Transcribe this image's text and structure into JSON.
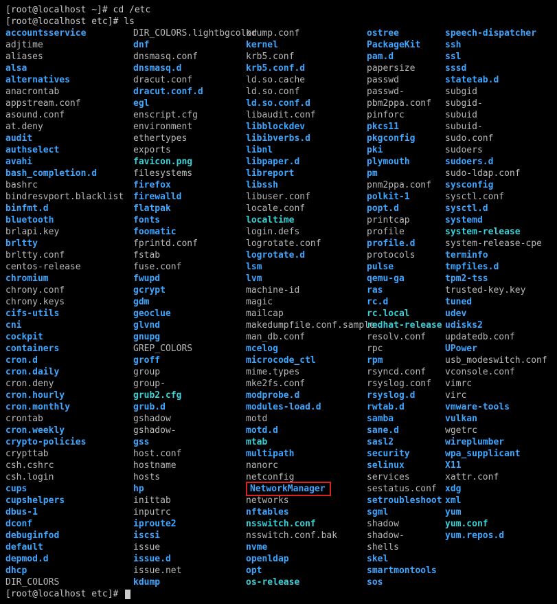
{
  "prompts": {
    "p1_prefix": "[root@localhost ~]# ",
    "p1_cmd": "cd /etc",
    "p2_prefix": "[root@localhost etc]# ",
    "p2_cmd": "ls",
    "p3_prefix": "[root@localhost etc]# "
  },
  "highlight_name": "NetworkManager",
  "columns": [
    [
      {
        "name": "accountsservice",
        "cls": "dir"
      },
      {
        "name": "adjtime",
        "cls": "file"
      },
      {
        "name": "aliases",
        "cls": "file"
      },
      {
        "name": "alsa",
        "cls": "dir"
      },
      {
        "name": "alternatives",
        "cls": "dir"
      },
      {
        "name": "anacrontab",
        "cls": "file"
      },
      {
        "name": "appstream.conf",
        "cls": "file"
      },
      {
        "name": "asound.conf",
        "cls": "file"
      },
      {
        "name": "at.deny",
        "cls": "file"
      },
      {
        "name": "audit",
        "cls": "dir"
      },
      {
        "name": "authselect",
        "cls": "dir"
      },
      {
        "name": "avahi",
        "cls": "dir"
      },
      {
        "name": "bash_completion.d",
        "cls": "dir"
      },
      {
        "name": "bashrc",
        "cls": "file"
      },
      {
        "name": "bindresvport.blacklist",
        "cls": "file"
      },
      {
        "name": "binfmt.d",
        "cls": "dir"
      },
      {
        "name": "bluetooth",
        "cls": "dir"
      },
      {
        "name": "brlapi.key",
        "cls": "file"
      },
      {
        "name": "brltty",
        "cls": "dir"
      },
      {
        "name": "brltty.conf",
        "cls": "file"
      },
      {
        "name": "centos-release",
        "cls": "file"
      },
      {
        "name": "chromium",
        "cls": "dir"
      },
      {
        "name": "chrony.conf",
        "cls": "file"
      },
      {
        "name": "chrony.keys",
        "cls": "file"
      },
      {
        "name": "cifs-utils",
        "cls": "dir"
      },
      {
        "name": "cni",
        "cls": "dir"
      },
      {
        "name": "cockpit",
        "cls": "dir"
      },
      {
        "name": "containers",
        "cls": "dir"
      },
      {
        "name": "cron.d",
        "cls": "dir"
      },
      {
        "name": "cron.daily",
        "cls": "dir"
      },
      {
        "name": "cron.deny",
        "cls": "file"
      },
      {
        "name": "cron.hourly",
        "cls": "dir"
      },
      {
        "name": "cron.monthly",
        "cls": "dir"
      },
      {
        "name": "crontab",
        "cls": "file"
      },
      {
        "name": "cron.weekly",
        "cls": "dir"
      },
      {
        "name": "crypto-policies",
        "cls": "dir"
      },
      {
        "name": "crypttab",
        "cls": "file"
      },
      {
        "name": "csh.cshrc",
        "cls": "file"
      },
      {
        "name": "csh.login",
        "cls": "file"
      },
      {
        "name": "cups",
        "cls": "dir"
      },
      {
        "name": "cupshelpers",
        "cls": "dir"
      },
      {
        "name": "dbus-1",
        "cls": "dir"
      },
      {
        "name": "dconf",
        "cls": "dir"
      },
      {
        "name": "debuginfod",
        "cls": "dir"
      },
      {
        "name": "default",
        "cls": "dir"
      },
      {
        "name": "depmod.d",
        "cls": "dir"
      },
      {
        "name": "dhcp",
        "cls": "dir"
      },
      {
        "name": "DIR_COLORS",
        "cls": "file"
      }
    ],
    [
      {
        "name": "DIR_COLORS.lightbgcolor",
        "cls": "file"
      },
      {
        "name": "dnf",
        "cls": "dir"
      },
      {
        "name": "dnsmasq.conf",
        "cls": "file"
      },
      {
        "name": "dnsmasq.d",
        "cls": "dir"
      },
      {
        "name": "dracut.conf",
        "cls": "file"
      },
      {
        "name": "dracut.conf.d",
        "cls": "dir"
      },
      {
        "name": "egl",
        "cls": "dir"
      },
      {
        "name": "enscript.cfg",
        "cls": "file"
      },
      {
        "name": "environment",
        "cls": "file"
      },
      {
        "name": "ethertypes",
        "cls": "file"
      },
      {
        "name": "exports",
        "cls": "file"
      },
      {
        "name": "favicon.png",
        "cls": "lnk"
      },
      {
        "name": "filesystems",
        "cls": "file"
      },
      {
        "name": "firefox",
        "cls": "dir"
      },
      {
        "name": "firewalld",
        "cls": "dir"
      },
      {
        "name": "flatpak",
        "cls": "dir"
      },
      {
        "name": "fonts",
        "cls": "dir"
      },
      {
        "name": "foomatic",
        "cls": "dir"
      },
      {
        "name": "fprintd.conf",
        "cls": "file"
      },
      {
        "name": "fstab",
        "cls": "file"
      },
      {
        "name": "fuse.conf",
        "cls": "file"
      },
      {
        "name": "fwupd",
        "cls": "dir"
      },
      {
        "name": "gcrypt",
        "cls": "dir"
      },
      {
        "name": "gdm",
        "cls": "dir"
      },
      {
        "name": "geoclue",
        "cls": "dir"
      },
      {
        "name": "glvnd",
        "cls": "dir"
      },
      {
        "name": "gnupg",
        "cls": "dir"
      },
      {
        "name": "GREP_COLORS",
        "cls": "file"
      },
      {
        "name": "groff",
        "cls": "dir"
      },
      {
        "name": "group",
        "cls": "file"
      },
      {
        "name": "group-",
        "cls": "file"
      },
      {
        "name": "grub2.cfg",
        "cls": "lnk"
      },
      {
        "name": "grub.d",
        "cls": "dir"
      },
      {
        "name": "gshadow",
        "cls": "file"
      },
      {
        "name": "gshadow-",
        "cls": "file"
      },
      {
        "name": "gss",
        "cls": "dir"
      },
      {
        "name": "host.conf",
        "cls": "file"
      },
      {
        "name": "hostname",
        "cls": "file"
      },
      {
        "name": "hosts",
        "cls": "file"
      },
      {
        "name": "hp",
        "cls": "dir"
      },
      {
        "name": "inittab",
        "cls": "file"
      },
      {
        "name": "inputrc",
        "cls": "file"
      },
      {
        "name": "iproute2",
        "cls": "dir"
      },
      {
        "name": "iscsi",
        "cls": "dir"
      },
      {
        "name": "issue",
        "cls": "file"
      },
      {
        "name": "issue.d",
        "cls": "dir"
      },
      {
        "name": "issue.net",
        "cls": "file"
      },
      {
        "name": "kdump",
        "cls": "dir"
      }
    ],
    [
      {
        "name": "kdump.conf",
        "cls": "file"
      },
      {
        "name": "kernel",
        "cls": "dir"
      },
      {
        "name": "krb5.conf",
        "cls": "file"
      },
      {
        "name": "krb5.conf.d",
        "cls": "dir"
      },
      {
        "name": "ld.so.cache",
        "cls": "file"
      },
      {
        "name": "ld.so.conf",
        "cls": "file"
      },
      {
        "name": "ld.so.conf.d",
        "cls": "dir"
      },
      {
        "name": "libaudit.conf",
        "cls": "file"
      },
      {
        "name": "libblockdev",
        "cls": "dir"
      },
      {
        "name": "libibverbs.d",
        "cls": "dir"
      },
      {
        "name": "libnl",
        "cls": "dir"
      },
      {
        "name": "libpaper.d",
        "cls": "dir"
      },
      {
        "name": "libreport",
        "cls": "dir"
      },
      {
        "name": "libssh",
        "cls": "dir"
      },
      {
        "name": "libuser.conf",
        "cls": "file"
      },
      {
        "name": "locale.conf",
        "cls": "file"
      },
      {
        "name": "localtime",
        "cls": "lnk"
      },
      {
        "name": "login.defs",
        "cls": "file"
      },
      {
        "name": "logrotate.conf",
        "cls": "file"
      },
      {
        "name": "logrotate.d",
        "cls": "dir"
      },
      {
        "name": "lsm",
        "cls": "dir"
      },
      {
        "name": "lvm",
        "cls": "dir"
      },
      {
        "name": "machine-id",
        "cls": "file"
      },
      {
        "name": "magic",
        "cls": "file"
      },
      {
        "name": "mailcap",
        "cls": "file"
      },
      {
        "name": "makedumpfile.conf.sample",
        "cls": "file"
      },
      {
        "name": "man_db.conf",
        "cls": "file"
      },
      {
        "name": "mcelog",
        "cls": "dir"
      },
      {
        "name": "microcode_ctl",
        "cls": "dir"
      },
      {
        "name": "mime.types",
        "cls": "file"
      },
      {
        "name": "mke2fs.conf",
        "cls": "file"
      },
      {
        "name": "modprobe.d",
        "cls": "dir"
      },
      {
        "name": "modules-load.d",
        "cls": "dir"
      },
      {
        "name": "motd",
        "cls": "file"
      },
      {
        "name": "motd.d",
        "cls": "dir"
      },
      {
        "name": "mtab",
        "cls": "lnk"
      },
      {
        "name": "multipath",
        "cls": "dir"
      },
      {
        "name": "nanorc",
        "cls": "file"
      },
      {
        "name": "netconfig",
        "cls": "file"
      },
      {
        "name": "NetworkManager",
        "cls": "dir",
        "hi": true
      },
      {
        "name": "networks",
        "cls": "file"
      },
      {
        "name": "nftables",
        "cls": "dir"
      },
      {
        "name": "nsswitch.conf",
        "cls": "lnk"
      },
      {
        "name": "nsswitch.conf.bak",
        "cls": "file"
      },
      {
        "name": "nvme",
        "cls": "dir"
      },
      {
        "name": "openldap",
        "cls": "dir"
      },
      {
        "name": "opt",
        "cls": "dir"
      },
      {
        "name": "os-release",
        "cls": "lnk"
      }
    ],
    [
      {
        "name": "ostree",
        "cls": "dir"
      },
      {
        "name": "PackageKit",
        "cls": "dir"
      },
      {
        "name": "pam.d",
        "cls": "dir"
      },
      {
        "name": "papersize",
        "cls": "file"
      },
      {
        "name": "passwd",
        "cls": "file"
      },
      {
        "name": "passwd-",
        "cls": "file"
      },
      {
        "name": "pbm2ppa.conf",
        "cls": "file"
      },
      {
        "name": "pinforc",
        "cls": "file"
      },
      {
        "name": "pkcs11",
        "cls": "dir"
      },
      {
        "name": "pkgconfig",
        "cls": "dir"
      },
      {
        "name": "pki",
        "cls": "dir"
      },
      {
        "name": "plymouth",
        "cls": "dir"
      },
      {
        "name": "pm",
        "cls": "dir"
      },
      {
        "name": "pnm2ppa.conf",
        "cls": "file"
      },
      {
        "name": "polkit-1",
        "cls": "dir"
      },
      {
        "name": "popt.d",
        "cls": "dir"
      },
      {
        "name": "printcap",
        "cls": "file"
      },
      {
        "name": "profile",
        "cls": "file"
      },
      {
        "name": "profile.d",
        "cls": "dir"
      },
      {
        "name": "protocols",
        "cls": "file"
      },
      {
        "name": "pulse",
        "cls": "dir"
      },
      {
        "name": "qemu-ga",
        "cls": "dir"
      },
      {
        "name": "ras",
        "cls": "dir"
      },
      {
        "name": "rc.d",
        "cls": "dir"
      },
      {
        "name": "rc.local",
        "cls": "lnk"
      },
      {
        "name": "redhat-release",
        "cls": "lnk"
      },
      {
        "name": "resolv.conf",
        "cls": "file"
      },
      {
        "name": "rpc",
        "cls": "file"
      },
      {
        "name": "rpm",
        "cls": "dir"
      },
      {
        "name": "rsyncd.conf",
        "cls": "file"
      },
      {
        "name": "rsyslog.conf",
        "cls": "file"
      },
      {
        "name": "rsyslog.d",
        "cls": "dir"
      },
      {
        "name": "rwtab.d",
        "cls": "dir"
      },
      {
        "name": "samba",
        "cls": "dir"
      },
      {
        "name": "sane.d",
        "cls": "dir"
      },
      {
        "name": "sasl2",
        "cls": "dir"
      },
      {
        "name": "security",
        "cls": "dir"
      },
      {
        "name": "selinux",
        "cls": "dir"
      },
      {
        "name": "services",
        "cls": "file"
      },
      {
        "name": "sestatus.conf",
        "cls": "file"
      },
      {
        "name": "setroubleshoot",
        "cls": "dir"
      },
      {
        "name": "sgml",
        "cls": "dir"
      },
      {
        "name": "shadow",
        "cls": "file"
      },
      {
        "name": "shadow-",
        "cls": "file"
      },
      {
        "name": "shells",
        "cls": "file"
      },
      {
        "name": "skel",
        "cls": "dir"
      },
      {
        "name": "smartmontools",
        "cls": "dir"
      },
      {
        "name": "sos",
        "cls": "dir"
      }
    ],
    [
      {
        "name": "speech-dispatcher",
        "cls": "dir"
      },
      {
        "name": "ssh",
        "cls": "dir"
      },
      {
        "name": "ssl",
        "cls": "dir"
      },
      {
        "name": "sssd",
        "cls": "dir"
      },
      {
        "name": "statetab.d",
        "cls": "dir"
      },
      {
        "name": "subgid",
        "cls": "file"
      },
      {
        "name": "subgid-",
        "cls": "file"
      },
      {
        "name": "subuid",
        "cls": "file"
      },
      {
        "name": "subuid-",
        "cls": "file"
      },
      {
        "name": "sudo.conf",
        "cls": "file"
      },
      {
        "name": "sudoers",
        "cls": "file"
      },
      {
        "name": "sudoers.d",
        "cls": "dir"
      },
      {
        "name": "sudo-ldap.conf",
        "cls": "file"
      },
      {
        "name": "sysconfig",
        "cls": "dir"
      },
      {
        "name": "sysctl.conf",
        "cls": "file"
      },
      {
        "name": "sysctl.d",
        "cls": "dir"
      },
      {
        "name": "systemd",
        "cls": "dir"
      },
      {
        "name": "system-release",
        "cls": "lnk"
      },
      {
        "name": "system-release-cpe",
        "cls": "file"
      },
      {
        "name": "terminfo",
        "cls": "dir"
      },
      {
        "name": "tmpfiles.d",
        "cls": "dir"
      },
      {
        "name": "tpm2-tss",
        "cls": "dir"
      },
      {
        "name": "trusted-key.key",
        "cls": "file"
      },
      {
        "name": "tuned",
        "cls": "dir"
      },
      {
        "name": "udev",
        "cls": "dir"
      },
      {
        "name": "udisks2",
        "cls": "dir"
      },
      {
        "name": "updatedb.conf",
        "cls": "file"
      },
      {
        "name": "UPower",
        "cls": "dir"
      },
      {
        "name": "usb_modeswitch.conf",
        "cls": "file"
      },
      {
        "name": "vconsole.conf",
        "cls": "file"
      },
      {
        "name": "vimrc",
        "cls": "file"
      },
      {
        "name": "virc",
        "cls": "file"
      },
      {
        "name": "vmware-tools",
        "cls": "dir"
      },
      {
        "name": "vulkan",
        "cls": "dir"
      },
      {
        "name": "wgetrc",
        "cls": "file"
      },
      {
        "name": "wireplumber",
        "cls": "dir"
      },
      {
        "name": "wpa_supplicant",
        "cls": "dir"
      },
      {
        "name": "X11",
        "cls": "dir"
      },
      {
        "name": "xattr.conf",
        "cls": "file"
      },
      {
        "name": "xdg",
        "cls": "dir"
      },
      {
        "name": "xml",
        "cls": "dir"
      },
      {
        "name": "yum",
        "cls": "dir"
      },
      {
        "name": "yum.conf",
        "cls": "lnk"
      },
      {
        "name": "yum.repos.d",
        "cls": "dir"
      }
    ]
  ]
}
